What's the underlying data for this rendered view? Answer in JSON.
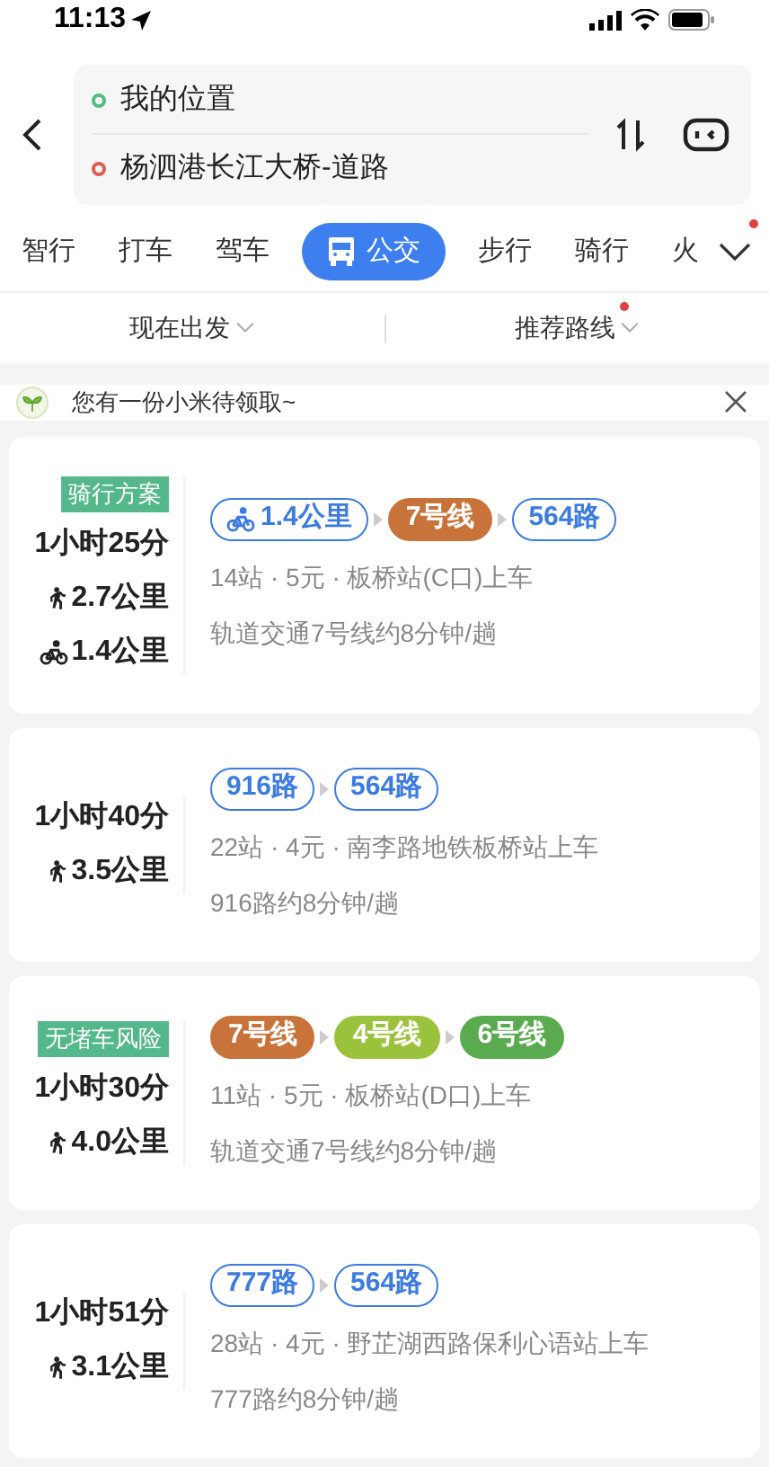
{
  "status_bar": {
    "time": "11:13"
  },
  "route": {
    "origin": "我的位置",
    "destination": "杨泗港长江大桥-道路"
  },
  "tabs": [
    {
      "label": "智行",
      "selected": false
    },
    {
      "label": "打车",
      "selected": false
    },
    {
      "label": "驾车",
      "selected": false
    },
    {
      "label": "公交",
      "selected": true
    },
    {
      "label": "步行",
      "selected": false
    },
    {
      "label": "骑行",
      "selected": false
    },
    {
      "label": "火",
      "selected": false
    }
  ],
  "filters": [
    {
      "label": "现在出发",
      "dot": false
    },
    {
      "label": "推荐路线",
      "dot": true
    }
  ],
  "notice": {
    "text": "您有一份小米待领取~"
  },
  "plans": [
    {
      "tag": "骑行方案",
      "duration": "1小时25分",
      "legs": [
        {
          "kind": "walk",
          "text": "2.7公里"
        },
        {
          "kind": "bike",
          "text": "1.4公里"
        }
      ],
      "segments": [
        {
          "kind": "bike",
          "label": "1.4公里"
        },
        {
          "kind": "subway",
          "label": "7号线",
          "color": "#c8733a"
        },
        {
          "kind": "bus",
          "label": "564路"
        }
      ],
      "info": "14站 · 5元 · 板桥站(C口)上车",
      "frequency": "轨道交通7号线约8分钟/趟"
    },
    {
      "duration": "1小时40分",
      "legs": [
        {
          "kind": "walk",
          "text": "3.5公里"
        }
      ],
      "segments": [
        {
          "kind": "bus",
          "label": "916路"
        },
        {
          "kind": "bus",
          "label": "564路"
        }
      ],
      "info": "22站 · 4元 · 南李路地铁板桥站上车",
      "frequency": "916路约8分钟/趟"
    },
    {
      "tag": "无堵车风险",
      "duration": "1小时30分",
      "legs": [
        {
          "kind": "walk",
          "text": "4.0公里"
        }
      ],
      "segments": [
        {
          "kind": "subway",
          "label": "7号线",
          "color": "#c8733a"
        },
        {
          "kind": "subway",
          "label": "4号线",
          "color": "#9ac23c"
        },
        {
          "kind": "subway",
          "label": "6号线",
          "color": "#5aab4f"
        }
      ],
      "info": "11站 · 5元 · 板桥站(D口)上车",
      "frequency": "轨道交通7号线约8分钟/趟"
    },
    {
      "duration": "1小时51分",
      "legs": [
        {
          "kind": "walk",
          "text": "3.1公里"
        }
      ],
      "segments": [
        {
          "kind": "bus",
          "label": "777路"
        },
        {
          "kind": "bus",
          "label": "564路"
        }
      ],
      "info": "28站 · 4元 · 野芷湖西路保利心语站上车",
      "frequency": "777路约8分钟/趟"
    }
  ]
}
